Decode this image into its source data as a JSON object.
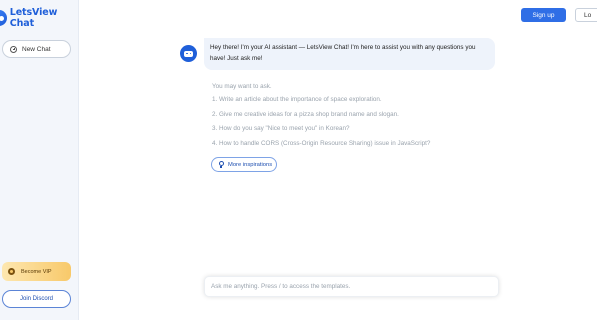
{
  "app": {
    "name": "LetsView Chat"
  },
  "sidebar": {
    "new_chat_label": "New Chat",
    "vip_label": "Become VIP",
    "discord_label": "Join Discord"
  },
  "header": {
    "signup_label": "Sign up",
    "login_label": "Lo"
  },
  "chat": {
    "greeting": "Hey there! I'm your AI assistant — LetsView Chat! I'm here to assist you with any questions you have! Just ask me!",
    "suggestions_title": "You may want to ask.",
    "suggestions": [
      "1. Write an article about the importance of space exploration.",
      "2. Give me creative ideas for a pizza shop brand name and slogan.",
      "3. How do you say \"Nice to meet you\" in Korean?",
      "4. How to handle CORS (Cross-Origin Resource Sharing) issue in JavaScript?"
    ],
    "more_label": "More inspirations"
  },
  "input": {
    "placeholder": "Ask me anything. Press / to access the templates."
  },
  "colors": {
    "brand": "#1f5fd9",
    "signup_bg": "#2f6ee6",
    "vip_gradient_start": "#fde7b0",
    "vip_gradient_end": "#f8c96a"
  },
  "icons": [
    "logo-icon",
    "plus-icon",
    "crown-icon",
    "bot-avatar-icon",
    "bulb-icon"
  ]
}
